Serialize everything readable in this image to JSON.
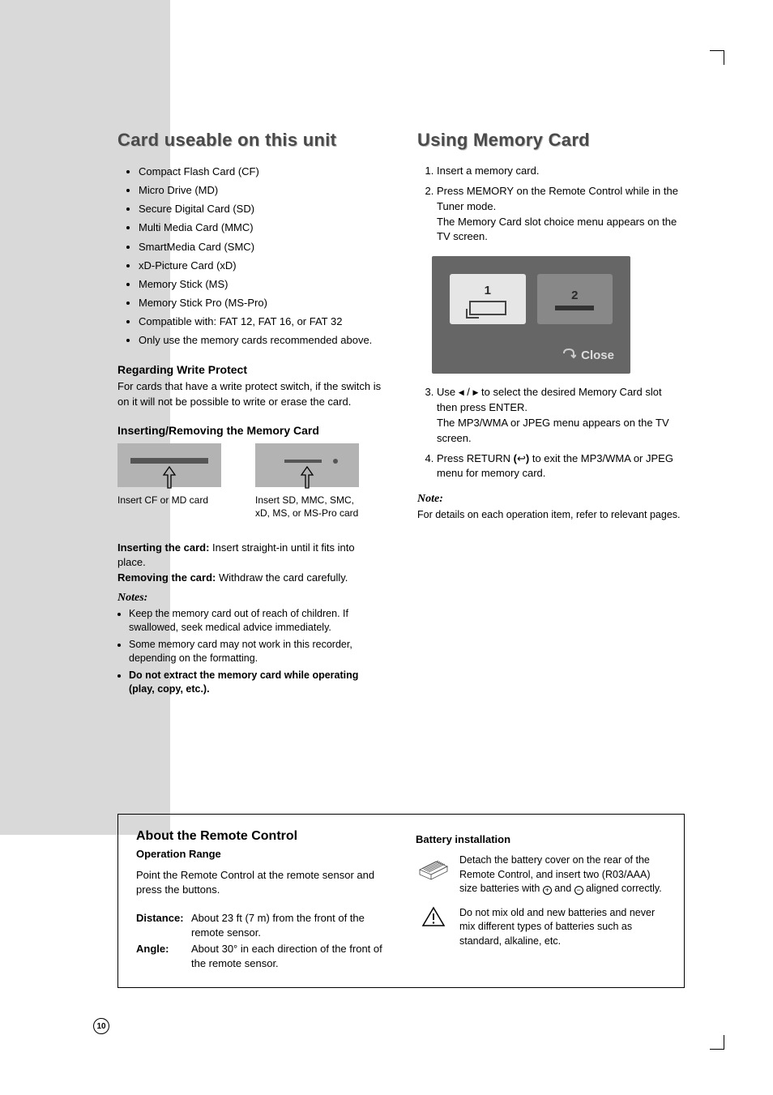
{
  "page_number": "10",
  "left": {
    "title": "Card useable on this unit",
    "bullets": [
      "Compact Flash Card (CF)",
      "Micro Drive (MD)",
      "Secure Digital Card (SD)",
      "Multi Media Card (MMC)",
      "SmartMedia Card (SMC)",
      "xD-Picture Card (xD)",
      "Memory Stick (MS)",
      "Memory Stick Pro (MS-Pro)",
      "Compatible with: FAT 12, FAT 16, or FAT 32",
      "Only use the memory cards recommended above."
    ],
    "wp_head": "Regarding Write Protect",
    "wp_body": "For cards that have a write protect switch, if the switch is on it will not be possible to write or erase the card.",
    "insert_head": "Inserting/Removing the Memory Card",
    "caption_left": "Insert CF or MD card",
    "caption_right": "Insert SD, MMC, SMC, xD, MS, or MS-Pro card",
    "insert_bold": "Inserting the card:",
    "insert_text": " Insert straight-in until it fits into place.",
    "remove_bold": "Removing the card:",
    "remove_text": " Withdraw the card carefully.",
    "notes_label": "Notes:",
    "notes": [
      "Keep the memory card out of reach of children. If swallowed, seek medical advice immediately.",
      "Some memory card may not work in this recorder, depending on the formatting."
    ],
    "note_bold": "Do not extract the memory card while operating (play, copy, etc.)."
  },
  "right": {
    "title": "Using Memory Card",
    "step1": "Insert a memory card.",
    "step2a": "Press MEMORY on the Remote Control while in the Tuner mode.",
    "step2b": "The Memory Card slot choice menu appears on the TV screen.",
    "menu_slot1": "1",
    "menu_slot2": "2",
    "menu_close": "Close",
    "step3_pre": "Use ",
    "step3_mid": " to select the desired Memory Card slot then press ENTER.",
    "step3_post": "The MP3/WMA or JPEG menu appears on the TV screen.",
    "step4_pre": "Press RETURN ",
    "step4_post": " to exit the MP3/WMA or JPEG menu for memory card.",
    "note_label": "Note:",
    "note_body": "For details on each operation item, refer to relevant pages."
  },
  "bottom": {
    "title": "About the Remote Control",
    "op_range_head": "Operation Range",
    "op_range_body": "Point the Remote Control at the remote sensor and press the buttons.",
    "distance_label": "Distance:",
    "distance_val": "About 23 ft (7 m) from the front of the remote sensor.",
    "angle_label": "Angle:",
    "angle_val": "About 30° in each direction of the front of the remote sensor.",
    "battery_head": "Battery installation",
    "battery_body_pre": "Detach the battery cover on the rear of the Remote Control, and insert two (R03/AAA) size batteries with ",
    "battery_body_post": " aligned correctly.",
    "and_word": " and ",
    "warning_body": "Do not mix old and new batteries and never mix different types of batteries such as standard, alkaline, etc."
  }
}
